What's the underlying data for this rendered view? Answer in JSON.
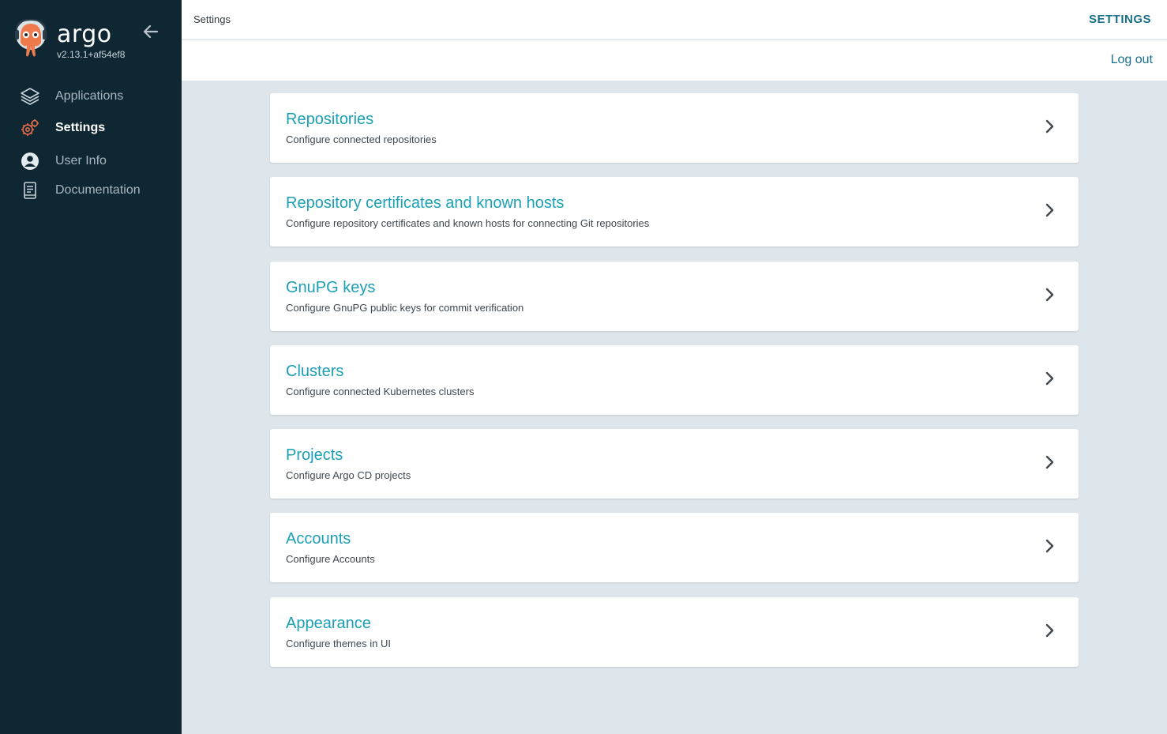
{
  "app": {
    "name": "argo",
    "version": "v2.13.1+af54ef8"
  },
  "sidebar": {
    "items": [
      {
        "label": "Applications",
        "icon": "layers-icon",
        "active": false
      },
      {
        "label": "Settings",
        "icon": "gears-icon",
        "active": true
      },
      {
        "label": "User Info",
        "icon": "user-circle-icon",
        "active": false
      },
      {
        "label": "Documentation",
        "icon": "book-icon",
        "active": false
      }
    ]
  },
  "topbar": {
    "breadcrumb": "Settings",
    "title": "SETTINGS",
    "logout_label": "Log out"
  },
  "settings": {
    "items": [
      {
        "title": "Repositories",
        "description": "Configure connected repositories"
      },
      {
        "title": "Repository certificates and known hosts",
        "description": "Configure repository certificates and known hosts for connecting Git repositories"
      },
      {
        "title": "GnuPG keys",
        "description": "Configure GnuPG public keys for commit verification"
      },
      {
        "title": "Clusters",
        "description": "Configure connected Kubernetes clusters"
      },
      {
        "title": "Projects",
        "description": "Configure Argo CD projects"
      },
      {
        "title": "Accounts",
        "description": "Configure Accounts"
      },
      {
        "title": "Appearance",
        "description": "Configure themes in UI"
      }
    ]
  },
  "colors": {
    "sidebar_bg": "#0f2733",
    "accent": "#1a9fb5",
    "title": "#1a6f8a",
    "settings_icon": "#e96d4c"
  }
}
